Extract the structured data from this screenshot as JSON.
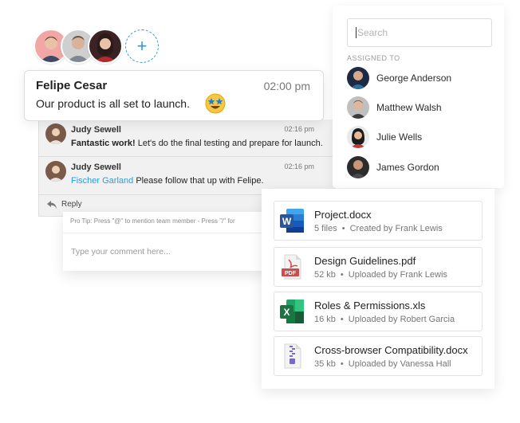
{
  "avatars": [
    {
      "name": "avatar-1",
      "bg": "#f3a6a6"
    },
    {
      "name": "avatar-2",
      "bg": "#c9c9c9"
    },
    {
      "name": "avatar-3",
      "bg": "#4a2a2a"
    }
  ],
  "add_button": {
    "label": "+"
  },
  "message": {
    "name": "Felipe Cesar",
    "time": "02:00 pm",
    "text": "Our product is all set to launch."
  },
  "thread": {
    "comments": [
      {
        "name": "Judy Sewell",
        "time": "02:16 pm",
        "bold": "Fantastic work!",
        "text": " Let's do the final testing and prepare for launch."
      },
      {
        "name": "Judy Sewell",
        "time": "02:16 pm",
        "mention": "Fischer Garland",
        "text": " Please follow that up with Felipe."
      }
    ],
    "reply_label": "Reply"
  },
  "comment_box": {
    "protip": "Pro Tip: Press \"@\" to mention team member  -  Press \"/\" for",
    "placeholder": "Type your comment here..."
  },
  "assign_panel": {
    "search_placeholder": "Search",
    "assigned_label": "ASSIGNED TO",
    "people": [
      {
        "name": "George Anderson"
      },
      {
        "name": "Matthew Walsh"
      },
      {
        "name": "Julie Wells"
      },
      {
        "name": "James Gordon"
      }
    ]
  },
  "files": [
    {
      "name": "Project.docx",
      "meta_a": "5 files",
      "meta_b": "Created by Frank Lewis",
      "icon": "word-icon"
    },
    {
      "name": "Design Guidelines.pdf",
      "meta_a": "52 kb",
      "meta_b": "Uploaded by Frank Lewis",
      "icon": "pdf-icon"
    },
    {
      "name": "Roles & Permissions.xls",
      "meta_a": "16 kb",
      "meta_b": "Uploaded by Robert Garcia",
      "icon": "excel-icon"
    },
    {
      "name": "Cross-browser Compatibility.docx",
      "meta_a": "35 kb",
      "meta_b": "Uploaded by Vanessa Hall",
      "icon": "zip-icon"
    }
  ],
  "pdf_icon_text": "PDF",
  "colors": {
    "accent": "#2f9bd8",
    "word": "#2b579a",
    "excel": "#1f7244",
    "pdf": "#d24b4b"
  }
}
